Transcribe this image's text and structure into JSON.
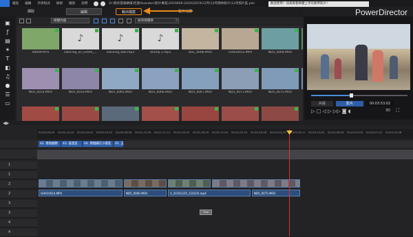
{
  "menu": {
    "items": [
      "檔案",
      "編輯",
      "外掛程式",
      "檢視",
      "播放",
      "說明"
    ],
    "path": "D:\\我的雲端硬碟\\吃素Youtuber\\影片專案\\2019009-2020\\2019\\12月\\12月雨林影片\\12月照片區.pds"
  },
  "tooltip": "歡迎使用！快來看看軟體上手的教學影片！",
  "brand": "PowerDirector",
  "tabs": {
    "capture": "擷取",
    "edit": "編輯",
    "produce": "輸出檔案",
    "disc": "製作光碟"
  },
  "library": {
    "filter": "媒體內容",
    "search_placeholder": "搜尋媒體庫",
    "media": [
      {
        "name": "00009.MTS"
      },
      {
        "name": "Dancing_on_Green_..."
      },
      {
        "name": "Dancing_Star.mp3"
      },
      {
        "name": "drump 1.mp3"
      },
      {
        "name": "DSC_0008.MOV"
      },
      {
        "name": "GH020012.MP4"
      },
      {
        "name": "ND5_0004.MOV"
      },
      {
        "name": ""
      },
      {
        "name": "ND5_0014.MOV"
      },
      {
        "name": "ND5_0016.MOV"
      },
      {
        "name": "ND5_0065.MOV"
      },
      {
        "name": "ND5_0066.MOV"
      },
      {
        "name": "ND5_0067.MOV"
      },
      {
        "name": "ND5_0071.MOV"
      },
      {
        "name": "ND5_0075.MOV"
      },
      {
        "name": ""
      },
      {
        "name": ""
      },
      {
        "name": ""
      },
      {
        "name": ""
      },
      {
        "name": ""
      },
      {
        "name": ""
      },
      {
        "name": ""
      },
      {
        "name": ""
      }
    ]
  },
  "preview": {
    "clip_tab": "片段",
    "movie_tab": "影片",
    "timecode": "00:03:53:02",
    "mode_3d": "3D"
  },
  "timeline": {
    "ticks": [
      "00;00;00;00",
      "00;00;14;18",
      "00;00;29;04",
      "00;00;43;22",
      "00;00;58;08",
      "00;01;12;26",
      "00;01;27;12",
      "00;01;42;00",
      "00;01;56;16",
      "00;02;11;04",
      "00;02;25;20",
      "00;02;40;08",
      "00;02;54;24",
      "00;03;09;12",
      "00;03;24;00",
      "00;03;38;16",
      "00;03;53;04",
      "00;04;07;22",
      "00;04;22;08"
    ],
    "chapters": [
      "42. 摸角順勝",
      "43. 低溫菜",
      "44. 那個婦訂小朋友",
      "45. 五"
    ],
    "audio_clips": [
      "GH010014.MP4",
      "ND5_0060.MOV",
      "V_20191225_110235.mp4",
      "ND5_0075.MOV"
    ],
    "text_clip": "Title",
    "track_labels": [
      "1",
      "1",
      "2",
      "2",
      "3",
      "3",
      "4",
      "4",
      "5",
      "5"
    ]
  }
}
